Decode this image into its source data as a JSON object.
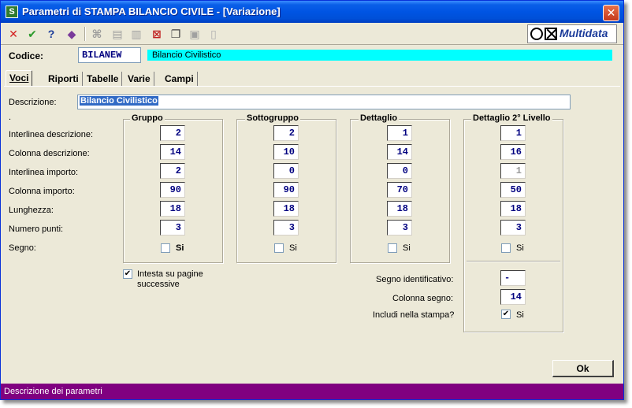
{
  "window": {
    "title": "Parametri di STAMPA BILANCIO CIVILE - [Variazione]",
    "app_icon": "S",
    "close_symbol": "✕"
  },
  "toolbar": {
    "buttons": [
      {
        "name": "cancel-icon",
        "glyph": "✕",
        "color": "#d42020"
      },
      {
        "name": "confirm-icon",
        "glyph": "✔",
        "color": "#2a9a2a"
      },
      {
        "name": "help-icon",
        "glyph": "?",
        "color": "#1a3c9a"
      },
      {
        "name": "book-icon",
        "glyph": "◆",
        "color": "#7a3a9a"
      },
      {
        "name": "binoculars-icon",
        "glyph": "⌘",
        "color": "#9a9a9a"
      },
      {
        "name": "print-icon",
        "glyph": "▤",
        "color": "#a0a0a0"
      },
      {
        "name": "print-preview-icon",
        "glyph": "▥",
        "color": "#a0a0a0"
      },
      {
        "name": "delete-record-icon",
        "glyph": "⊠",
        "color": "#c02020"
      },
      {
        "name": "copy-icon",
        "glyph": "❐",
        "color": "#404040"
      },
      {
        "name": "paste-icon",
        "glyph": "▣",
        "color": "#a0a0a0"
      },
      {
        "name": "new-document-icon",
        "glyph": "▯",
        "color": "#b0b0b0"
      }
    ],
    "logo_text": "Multidata"
  },
  "codice": {
    "label": "Codice:",
    "value": "BILANEW",
    "description": "Bilancio Civilistico"
  },
  "tabs": [
    {
      "label": "Voci"
    },
    {
      "label": "Riporti"
    },
    {
      "label": "Tabelle"
    },
    {
      "label": "Varie"
    },
    {
      "label": "Campi"
    }
  ],
  "descrizione": {
    "label": "Descrizione:",
    "value": "Bilancio Civilistico"
  },
  "dot_label": ".",
  "row_labels": [
    "Interlinea descrizione:",
    "Colonna descrizione:",
    "Interlinea importo:",
    "Colonna importo:",
    "Lunghezza:",
    "Numero punti:",
    "Segno:"
  ],
  "groups": [
    {
      "title": "Gruppo",
      "values": [
        "2",
        "14",
        "2",
        "90",
        "18",
        "3"
      ],
      "segno_label": "Si",
      "segno_checked": false
    },
    {
      "title": "Sottogruppo",
      "values": [
        "2",
        "10",
        "0",
        "90",
        "18",
        "3"
      ],
      "segno_label": "Si",
      "segno_checked": false
    },
    {
      "title": "Dettaglio",
      "values": [
        "1",
        "14",
        "0",
        "70",
        "18",
        "3"
      ],
      "segno_label": "Si",
      "segno_checked": false
    },
    {
      "title": "Dettaglio 2° Livello",
      "values": [
        "1",
        "16",
        "1",
        "50",
        "18",
        "3"
      ],
      "segno_label": "Si",
      "segno_checked": false
    }
  ],
  "intesta": {
    "label_line1": "Intesta su pagine",
    "label_line2": "successive",
    "checked": true,
    "check_mark": "✔"
  },
  "segno_identificativo": {
    "label": "Segno identificativo:",
    "value": "-"
  },
  "colonna_segno": {
    "label": "Colonna segno:",
    "value": "14"
  },
  "includi": {
    "label": "Includi nella stampa?",
    "checked": true,
    "check_label": "Si",
    "check_mark": "✔"
  },
  "ok_button": {
    "label": "Ok"
  },
  "status": {
    "text": "Descrizione dei parametri"
  },
  "colors": {
    "status_bg": "#800080",
    "code_desc_bg": "#00ffff",
    "title_bar": "#0054e3",
    "value_text": "#000080"
  }
}
